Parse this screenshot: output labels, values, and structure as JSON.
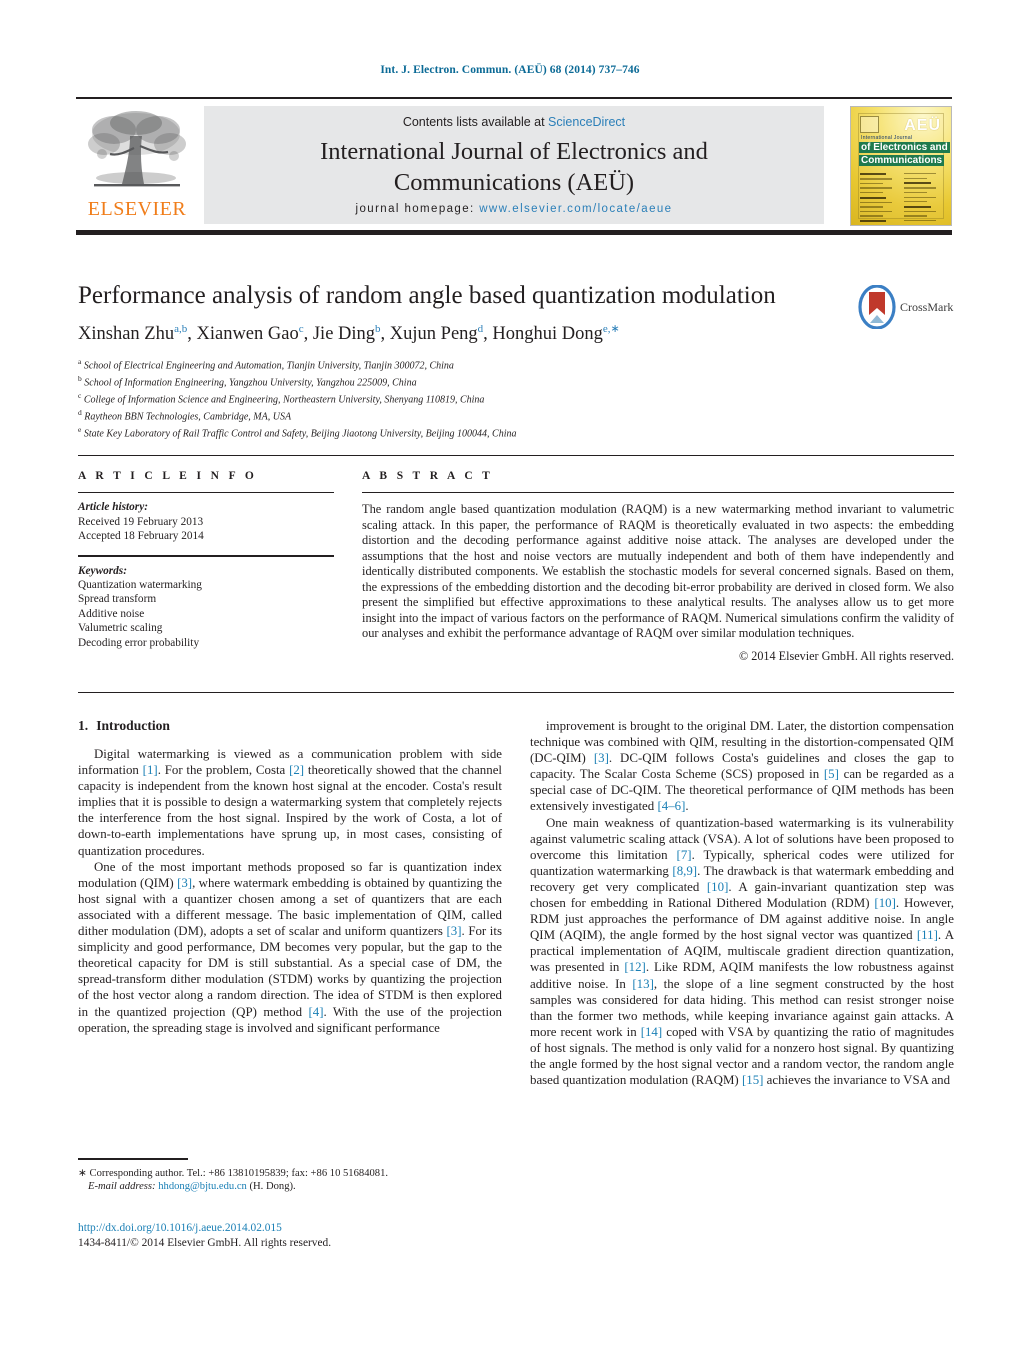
{
  "running_head": "Int. J. Electron. Commun. (AEÜ) 68 (2014) 737–746",
  "masthead": {
    "contents_prefix": "Contents lists available at ",
    "sciencedirect": "ScienceDirect",
    "journal_title_line1": "International Journal of Electronics and",
    "journal_title_line2": "Communications (AEÜ)",
    "homepage_label": "journal homepage:",
    "homepage_url": "www.elsevier.com/locate/aeue",
    "publisher_wordmark": "ELSEVIER",
    "cover": {
      "badge": "AEÜ",
      "line_small": "International Journal",
      "green_line1": "of Electronics and",
      "green_line2": "Communications"
    },
    "colors": {
      "link_blue": "#2b7fb8",
      "elsevier_orange": "#f07d1a",
      "band_grey": "#e6e7e8"
    }
  },
  "title_block": {
    "title": "Performance analysis of random angle based quantization modulation",
    "authors": [
      {
        "name": "Xinshan Zhu",
        "sup": "a,b",
        "sep": ", "
      },
      {
        "name": "Xianwen Gao",
        "sup": "c",
        "sep": ", "
      },
      {
        "name": "Jie Ding",
        "sup": "b",
        "sep": ", "
      },
      {
        "name": "Xujun Peng",
        "sup": "d",
        "sep": ", "
      },
      {
        "name": "Honghui Dong",
        "sup": "e,∗",
        "sep": ""
      }
    ],
    "affiliations": [
      {
        "marker": "a",
        "text": "School of Electrical Engineering and Automation, Tianjin University, Tianjin 300072, China"
      },
      {
        "marker": "b",
        "text": "School of Information Engineering, Yangzhou University, Yangzhou 225009, China"
      },
      {
        "marker": "c",
        "text": "College of Information Science and Engineering, Northeastern University, Shenyang 110819, China"
      },
      {
        "marker": "d",
        "text": "Raytheon BBN Technologies, Cambridge, MA, USA"
      },
      {
        "marker": "e",
        "text": "State Key Laboratory of Rail Traffic Control and Safety, Beijing Jiaotong University, Beijing 100044, China"
      }
    ],
    "crossmark_label": "CrossMark"
  },
  "article_info": {
    "heading": "A R T I C L E    I N F O",
    "history_label": "Article history:",
    "history": [
      "Received 19 February 2013",
      "Accepted 18 February 2014"
    ],
    "keywords_label": "Keywords:",
    "keywords": [
      "Quantization watermarking",
      "Spread transform",
      "Additive noise",
      "Valumetric scaling",
      "Decoding error probability"
    ]
  },
  "abstract": {
    "heading": "A B S T R A C T",
    "text": "The random angle based quantization modulation (RAQM) is a new watermarking method invariant to valumetric scaling attack. In this paper, the performance of RAQM is theoretically evaluated in two aspects: the embedding distortion and the decoding performance against additive noise attack. The analyses are developed under the assumptions that the host and noise vectors are mutually independent and both of them have independently and identically distributed components. We establish the stochastic models for several concerned signals. Based on them, the expressions of the embedding distortion and the decoding bit-error probability are derived in closed form. We also present the simplified but effective approximations to these analytical results. The analyses allow us to get more insight into the impact of various factors on the performance of RAQM. Numerical simulations confirm the validity of our analyses and exhibit the performance advantage of RAQM over similar modulation techniques.",
    "copyright": "© 2014 Elsevier GmbH. All rights reserved."
  },
  "introduction": {
    "number": "1.",
    "heading": "Introduction",
    "left_paragraphs": [
      "Digital watermarking is viewed as a communication problem with side information [1]. For the problem, Costa [2] theoretically showed that the channel capacity is independent from the known host signal at the encoder. Costa's result implies that it is possible to design a watermarking system that completely rejects the interference from the host signal. Inspired by the work of Costa, a lot of down-to-earth implementations have sprung up, in most cases, consisting of quantization procedures.",
      "One of the most important methods proposed so far is quantization index modulation (QIM) [3], where watermark embedding is obtained by quantizing the host signal with a quantizer chosen among a set of quantizers that are each associated with a different message. The basic implementation of QIM, called dither modulation (DM), adopts a set of scalar and uniform quantizers [3]. For its simplicity and good performance, DM becomes very popular, but the gap to the theoretical capacity for DM is still substantial. As a special case of DM, the spread-transform dither modulation (STDM) works by quantizing the projection of the host vector along a random direction. The idea of STDM is then explored in the quantized projection (QP) method [4]. With the use of the projection operation, the spreading stage is involved and significant performance"
    ],
    "right_paragraphs": [
      "improvement is brought to the original DM. Later, the distortion compensation technique was combined with QIM, resulting in the distortion-compensated QIM (DC-QIM) [3]. DC-QIM follows Costa's guidelines and closes the gap to capacity. The Scalar Costa Scheme (SCS) proposed in [5] can be regarded as a special case of DC-QIM. The theoretical performance of QIM methods has been extensively investigated [4–6].",
      "One main weakness of quantization-based watermarking is its vulnerability against valumetric scaling attack (VSA). A lot of solutions have been proposed to overcome this limitation [7]. Typically, spherical codes were utilized for quantization watermarking [8,9]. The drawback is that watermark embedding and recovery get very complicated [10]. A gain-invariant quantization step was chosen for embedding in Rational Dithered Modulation (RDM) [10]. However, RDM just approaches the performance of DM against additive noise. In angle QIM (AQIM), the angle formed by the host signal vector was quantized [11]. A practical implementation of AQIM, multiscale gradient direction quantization, was presented in [12]. Like RDM, AQIM manifests the low robustness against additive noise. In [13], the slope of a line segment constructed by the host samples was considered for data hiding. This method can resist stronger noise than the former two methods, while keeping invariance against gain attacks. A more recent work in [14] coped with VSA by quantizing the ratio of magnitudes of host signals. The method is only valid for a nonzero host signal. By quantizing the angle formed by the host signal vector and a random vector, the random angle based quantization modulation (RAQM) [15] achieves the invariance to VSA and"
    ]
  },
  "footnote": {
    "marker": "∗",
    "corresponding": "Corresponding author. Tel.: +86 13810195839; fax: +86 10 51684081.",
    "email_label": "E-mail address:",
    "email": "hhdong@bjtu.edu.cn",
    "email_owner": "(H. Dong)."
  },
  "doi_block": {
    "doi_url": "http://dx.doi.org/10.1016/j.aeue.2014.02.015",
    "issn_line": "1434-8411/© 2014 Elsevier GmbH. All rights reserved."
  }
}
